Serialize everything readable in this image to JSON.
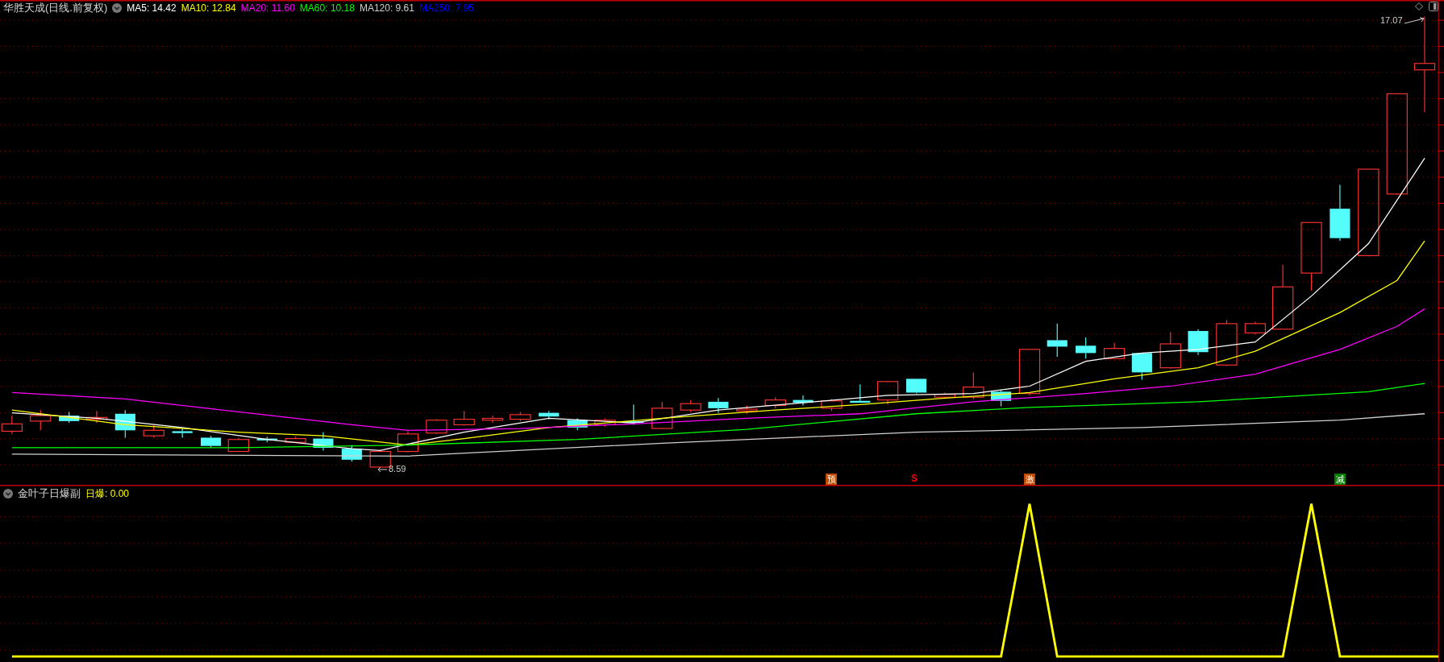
{
  "header": {
    "title": "华胜天成(日线.前复权)",
    "ma": [
      {
        "label": "MA5: 14.42",
        "color": "#ffffff"
      },
      {
        "label": "MA10: 12.84",
        "color": "#ffff00"
      },
      {
        "label": "MA20: 11.60",
        "color": "#ff00ff"
      },
      {
        "label": "MA60: 10.18",
        "color": "#00ff00"
      },
      {
        "label": "MA120: 9.61",
        "color": "#d0d0d0"
      },
      {
        "label": "MA250: 7.95",
        "color": "#0000ff"
      }
    ]
  },
  "price_labels": [
    {
      "text": "17.07",
      "kind": "high"
    },
    {
      "text": "8.59",
      "kind": "low"
    }
  ],
  "signals": [
    {
      "text": "预",
      "kind": "badge",
      "color": "#c04a00"
    },
    {
      "text": "S",
      "kind": "mark",
      "color": "#ff0000"
    },
    {
      "text": "激",
      "kind": "badge",
      "color": "#c04a00"
    },
    {
      "text": "减",
      "kind": "badge",
      "color": "#008000"
    }
  ],
  "indicator": {
    "title": "金叶子日爆副",
    "series": [
      {
        "label": "日爆: 0.00",
        "color": "#ffff00"
      }
    ]
  }
}
